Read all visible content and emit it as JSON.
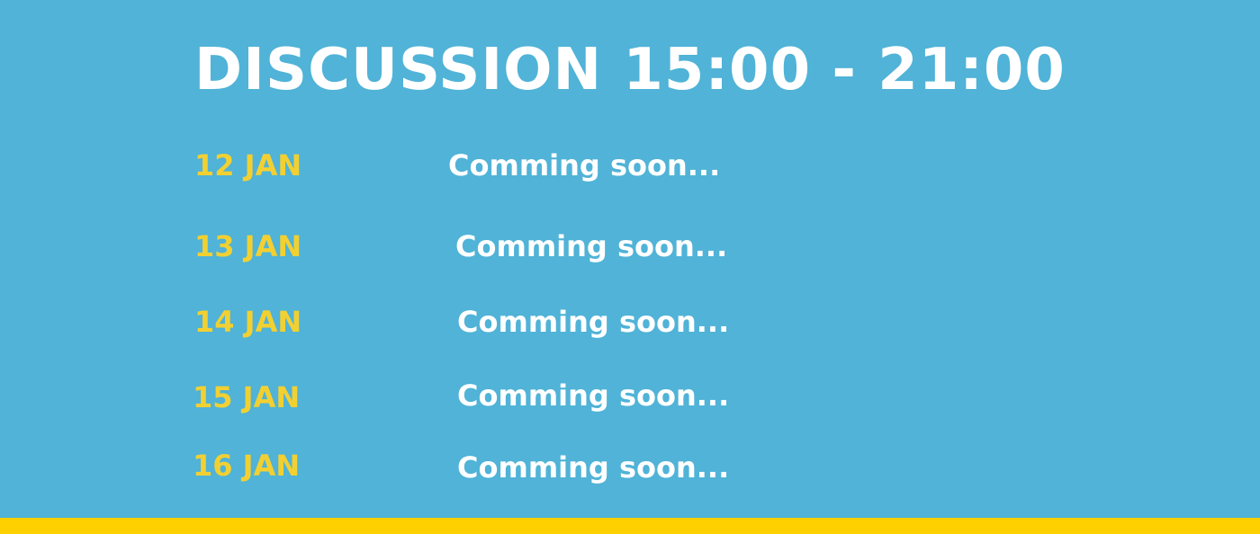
{
  "colors": {
    "background": "#50b3d7",
    "date_text": "#f2d032",
    "bottom_bar": "#ffd000",
    "text": "#ffffff"
  },
  "title": "DISCUSSION 15:00 - 21:00",
  "schedule": [
    {
      "date": "12 JAN",
      "status": "Comming soon..."
    },
    {
      "date": "13 JAN",
      "status": "Comming soon..."
    },
    {
      "date": "14 JAN",
      "status": "Comming soon..."
    },
    {
      "date": "15 JAN",
      "status": "Comming soon..."
    },
    {
      "date": "16 JAN",
      "status": "Comming soon..."
    }
  ]
}
